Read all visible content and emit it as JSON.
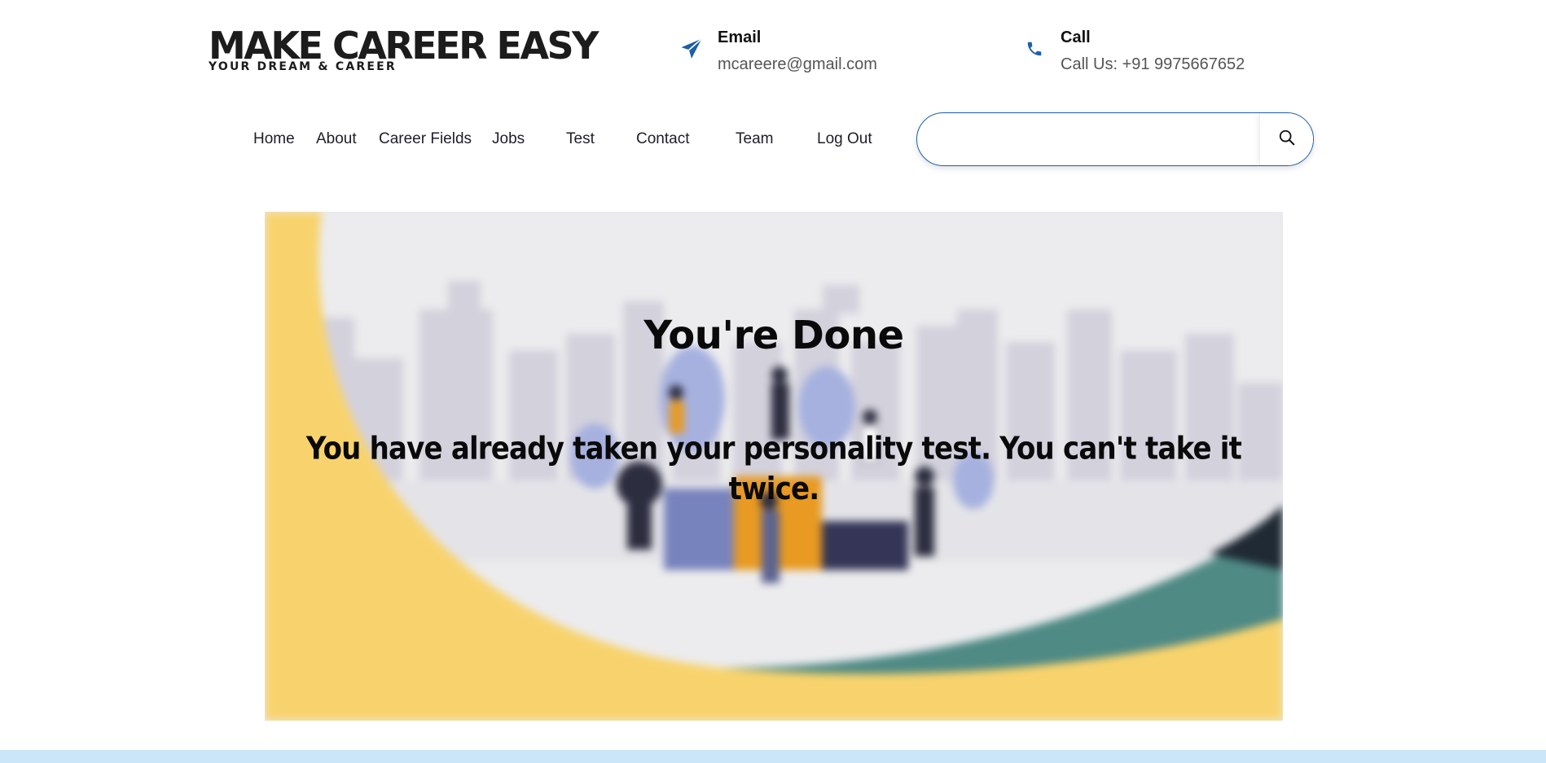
{
  "brand": {
    "title": "MAKE CAREER EASY",
    "tagline": "YOUR DREAM & CAREER"
  },
  "contacts": {
    "email": {
      "icon": "paper-plane-icon",
      "label": "Email",
      "value": "mcareere@gmail.com"
    },
    "call": {
      "icon": "phone-icon",
      "label": "Call",
      "value": "Call Us: +91 9975667652"
    }
  },
  "nav": {
    "items": [
      {
        "label": "Home"
      },
      {
        "label": "About"
      },
      {
        "label": "Career Fields"
      },
      {
        "label": "Jobs"
      },
      {
        "label": "Test"
      },
      {
        "label": "Contact"
      },
      {
        "label": "Team"
      },
      {
        "label": "Log Out"
      }
    ]
  },
  "search": {
    "value": "",
    "icon": "search-icon"
  },
  "hero": {
    "title": "You're Done",
    "message": "You have already taken your personality test. You can't take it twice."
  },
  "colors": {
    "accent": "#1d5fa8",
    "hero_yellow": "#f8d36d",
    "hero_teal": "#4f8a85",
    "footer_band": "#cbe6f8"
  }
}
